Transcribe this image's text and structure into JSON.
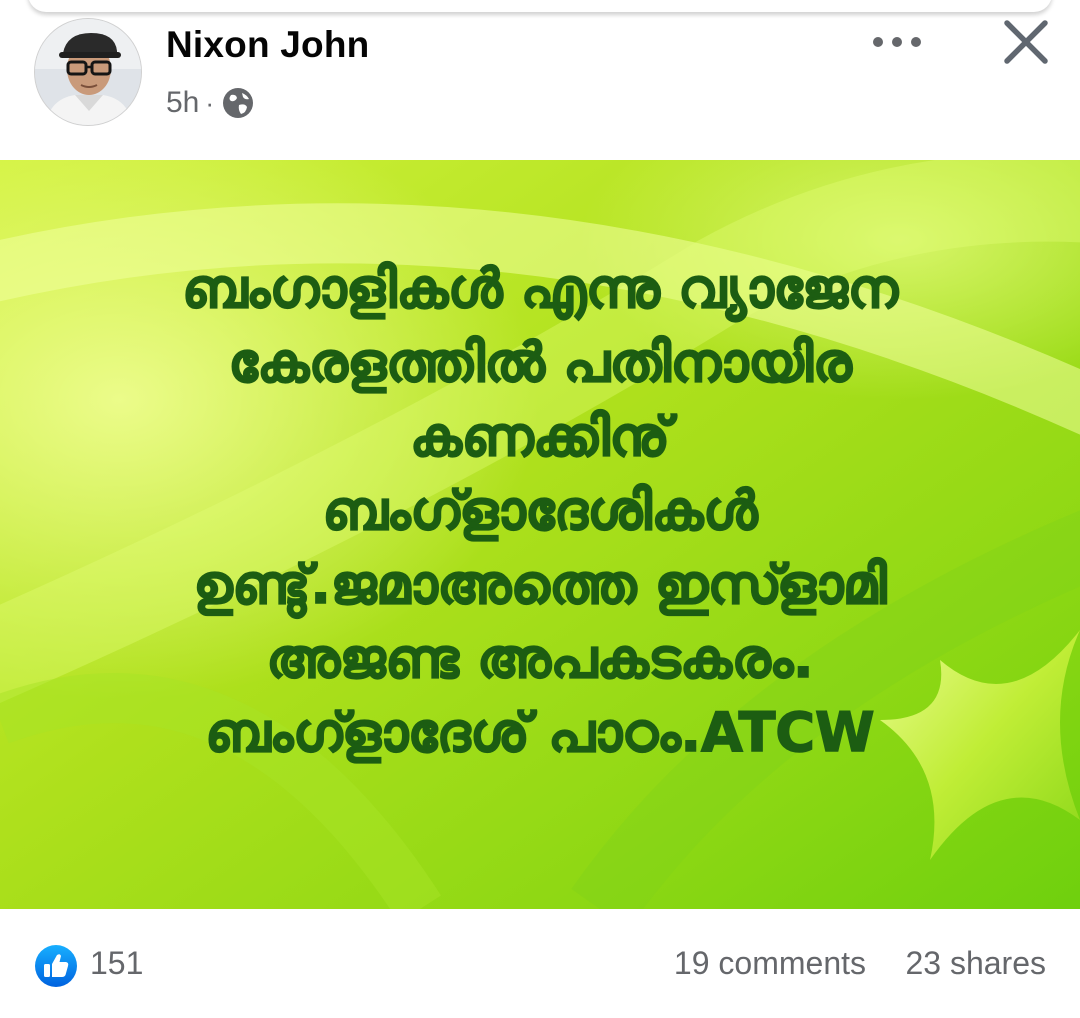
{
  "post": {
    "author": "Nixon John",
    "time": "5h",
    "separator": "·",
    "privacy_icon": "globe-icon",
    "more_icon": "more-horizontal-icon",
    "close_icon": "close-icon",
    "image_text_lines": [
      "ബംഗാളികൾ എന്നു വ്യാജേന",
      "കേരളത്തിൽ പതിനായിര",
      "കണക്കിനു്",
      "ബംഗ്ളാദേശികൾ",
      "ഉണ്ടു്.ജമാഅത്തെ ഇസ്ളാമി",
      "അജണ്ട അപകടകരം.",
      "ബംഗ്ളാദേശ് പാഠം.ATCW"
    ]
  },
  "footer": {
    "like_icon": "like-thumb-icon",
    "reactions": "151",
    "comments": "19 comments",
    "shares": "23 shares"
  },
  "colors": {
    "text_green": "#1c5d12",
    "bg_lime": "#b6e61d",
    "like_blue": "#1877f2",
    "meta_gray": "#65676b"
  }
}
